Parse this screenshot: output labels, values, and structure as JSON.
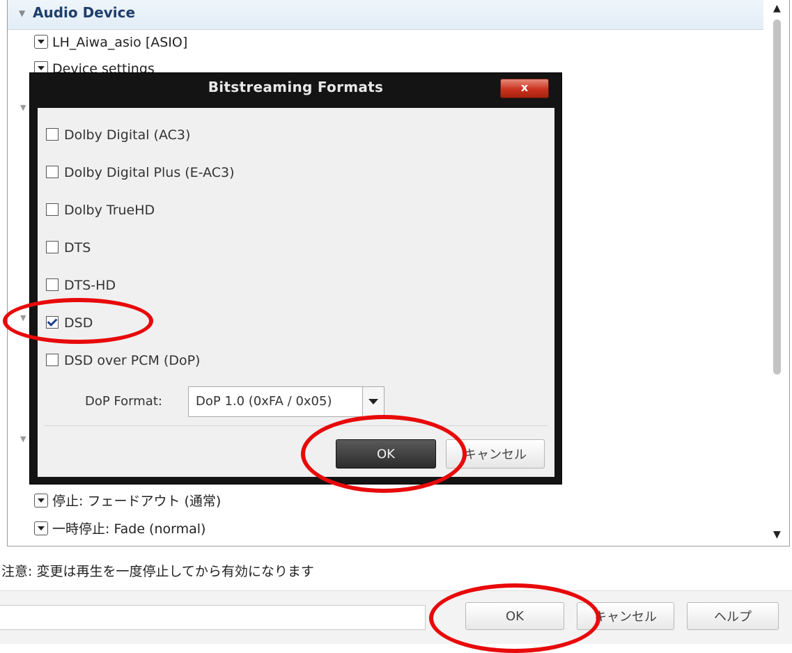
{
  "settings": {
    "section_title": "Audio Device",
    "device_dropdown": "LH_Aiwa_asio [ASIO]",
    "device_settings_label": "Device settings",
    "stop_dropdown": "停止: フェードアウト (通常)",
    "pause_dropdown": "一時停止: Fade (normal)"
  },
  "note": "注意: 変更は再生を一度停止してから有効になります",
  "footer": {
    "ok_label": "OK",
    "cancel_label": "キャンセル",
    "help_label": "ヘルプ"
  },
  "dialog": {
    "title": "Bitstreaming Formats",
    "close_label": "x",
    "formats": [
      {
        "label": "Dolby Digital (AC3)",
        "checked": false
      },
      {
        "label": "Dolby Digital Plus (E-AC3)",
        "checked": false
      },
      {
        "label": "Dolby TrueHD",
        "checked": false
      },
      {
        "label": "DTS",
        "checked": false
      },
      {
        "label": "DTS-HD",
        "checked": false
      },
      {
        "label": "DSD",
        "checked": true
      },
      {
        "label": "DSD over PCM (DoP)",
        "checked": false
      }
    ],
    "dop_format_label": "DoP Format:",
    "dop_format_value": "DoP 1.0 (0xFA / 0x05)",
    "ok_label": "OK",
    "cancel_label": "キャンセル"
  },
  "colors": {
    "annotation": "#e8090a",
    "dialog_frame": "#141414",
    "close_button": "#c9321f",
    "section_title": "#1f3e6b"
  },
  "icons": {
    "collapse": "triangle-down-icon",
    "dropdown": "chevron-down-icon",
    "close": "close-icon",
    "checkbox": "checkbox-icon"
  }
}
